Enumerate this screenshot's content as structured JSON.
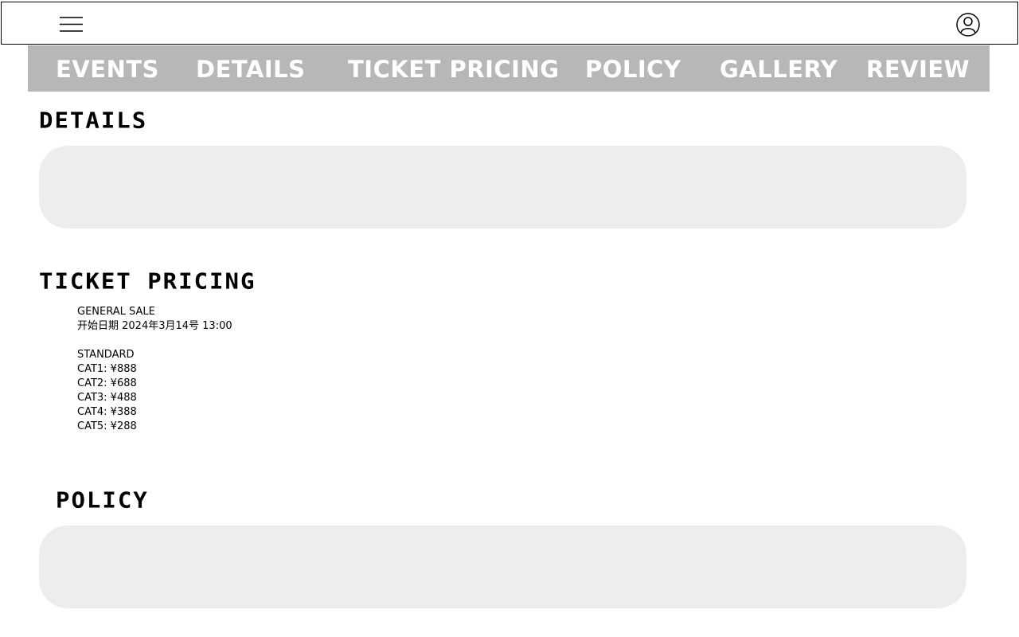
{
  "header": {
    "menu_icon": "hamburger-menu-icon",
    "user_icon": "user-account-icon"
  },
  "nav": {
    "items": [
      {
        "label": "EVENTS"
      },
      {
        "label": "DETAILS"
      },
      {
        "label": "TICKET PRICING"
      },
      {
        "label": "POLICY"
      },
      {
        "label": "GALLERY"
      },
      {
        "label": "REVIEW"
      }
    ],
    "background_color": "#b6b7b9",
    "text_color": "#ffffff"
  },
  "sections": {
    "details": {
      "title": "DETAILS"
    },
    "ticket_pricing": {
      "title": "TICKET PRICING",
      "sale_label": "GENERAL SALE",
      "start_date": "开始日期 2024年3月14号 13:00",
      "tier_label": "STANDARD",
      "categories": [
        "CAT1: ¥888",
        "CAT2: ¥688",
        "CAT3: ¥488",
        "CAT4: ¥388",
        "CAT5: ¥288"
      ]
    },
    "policy": {
      "title": "POLICY"
    }
  },
  "colors": {
    "content_box": "#ededed"
  }
}
